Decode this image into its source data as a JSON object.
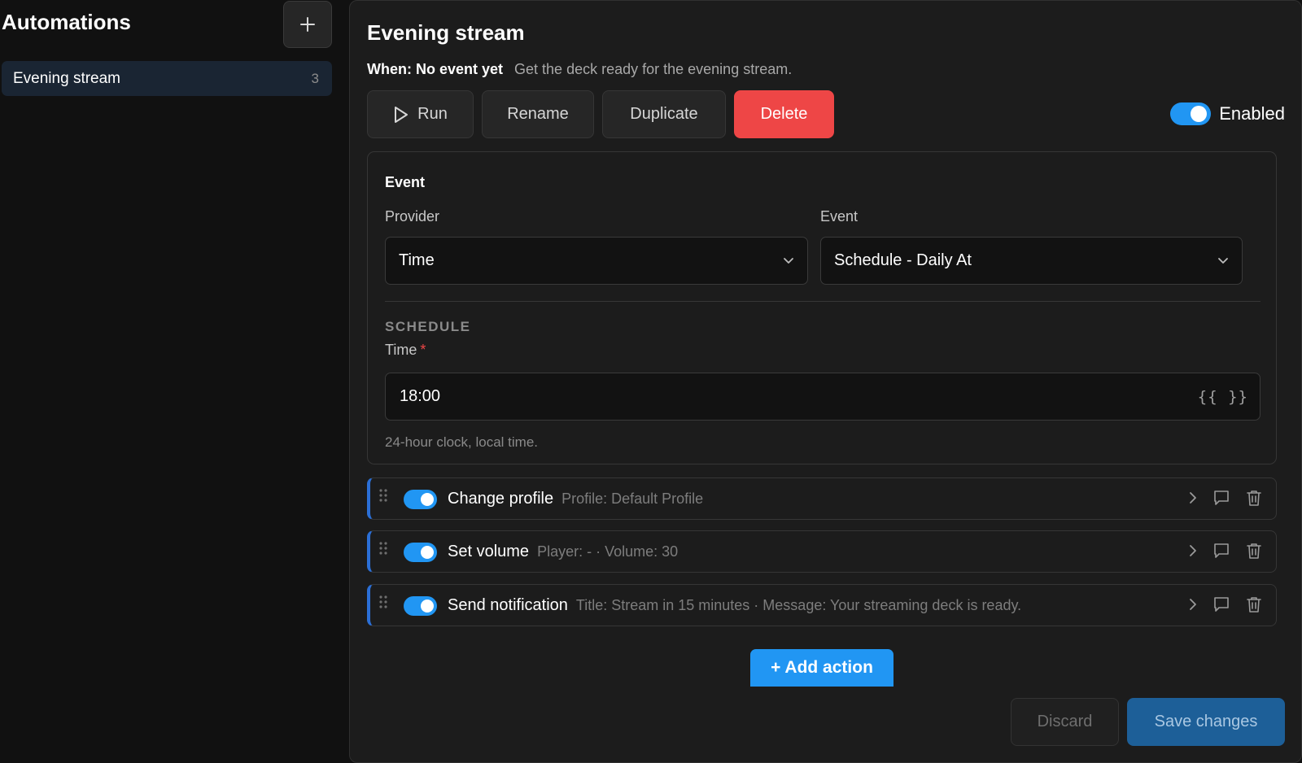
{
  "sidebar": {
    "title": "Automations",
    "add_button": "+",
    "items": [
      {
        "label": "Evening stream",
        "count": "3"
      }
    ]
  },
  "main": {
    "title": "Evening stream",
    "when_label": "When: No event yet",
    "description": "Get the deck ready for the evening stream.",
    "buttons": {
      "run": "Run",
      "rename": "Rename",
      "duplicate": "Duplicate",
      "delete": "Delete"
    },
    "enabled_label": "Enabled",
    "enabled": true
  },
  "event": {
    "card_title": "Event",
    "provider_label": "Provider",
    "provider_value": "Time",
    "event_label": "Event",
    "event_value": "Schedule - Daily At",
    "section_title": "SCHEDULE",
    "time_label": "Time",
    "required_mark": "*",
    "time_value": "18:00",
    "template_icon": "{{ }}",
    "hint": "24-hour clock, local time."
  },
  "actions": [
    {
      "name": "Change profile",
      "summary": "Profile: Default Profile",
      "enabled": true
    },
    {
      "name": "Set volume",
      "summary": "Player: - · Volume: 30",
      "enabled": true
    },
    {
      "name": "Send notification",
      "summary": "Title: Stream in 15 minutes · Message: Your streaming deck is ready.",
      "enabled": true
    }
  ],
  "footer": {
    "add_action": "+ Add action",
    "discard": "Discard",
    "save": "Save changes"
  },
  "colors": {
    "accent": "#2196f3",
    "danger": "#ee4646",
    "background": "#111111",
    "panel": "#1c1c1c"
  }
}
